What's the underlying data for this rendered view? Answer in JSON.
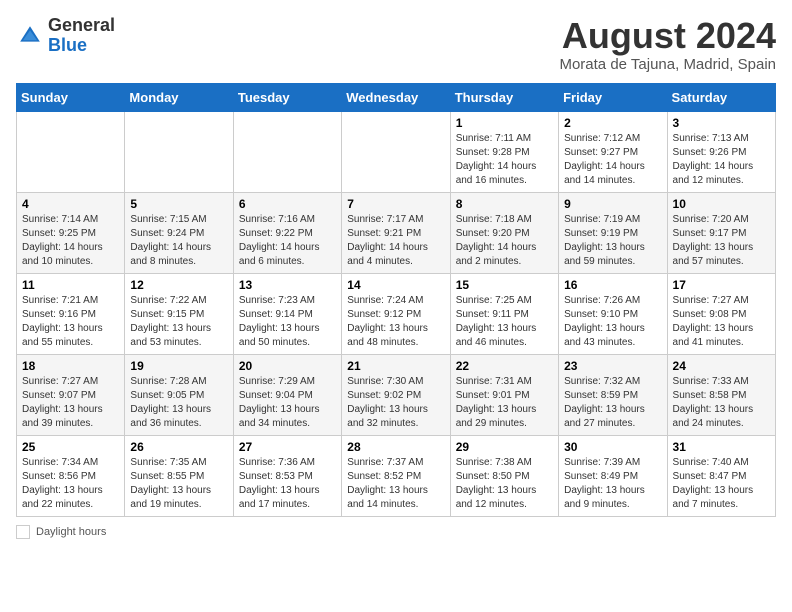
{
  "header": {
    "logo_general": "General",
    "logo_blue": "Blue",
    "title": "August 2024",
    "subtitle": "Morata de Tajuna, Madrid, Spain"
  },
  "weekdays": [
    "Sunday",
    "Monday",
    "Tuesday",
    "Wednesday",
    "Thursday",
    "Friday",
    "Saturday"
  ],
  "weeks": [
    [
      {
        "day": "",
        "info": ""
      },
      {
        "day": "",
        "info": ""
      },
      {
        "day": "",
        "info": ""
      },
      {
        "day": "",
        "info": ""
      },
      {
        "day": "1",
        "info": "Sunrise: 7:11 AM\nSunset: 9:28 PM\nDaylight: 14 hours\nand 16 minutes."
      },
      {
        "day": "2",
        "info": "Sunrise: 7:12 AM\nSunset: 9:27 PM\nDaylight: 14 hours\nand 14 minutes."
      },
      {
        "day": "3",
        "info": "Sunrise: 7:13 AM\nSunset: 9:26 PM\nDaylight: 14 hours\nand 12 minutes."
      }
    ],
    [
      {
        "day": "4",
        "info": "Sunrise: 7:14 AM\nSunset: 9:25 PM\nDaylight: 14 hours\nand 10 minutes."
      },
      {
        "day": "5",
        "info": "Sunrise: 7:15 AM\nSunset: 9:24 PM\nDaylight: 14 hours\nand 8 minutes."
      },
      {
        "day": "6",
        "info": "Sunrise: 7:16 AM\nSunset: 9:22 PM\nDaylight: 14 hours\nand 6 minutes."
      },
      {
        "day": "7",
        "info": "Sunrise: 7:17 AM\nSunset: 9:21 PM\nDaylight: 14 hours\nand 4 minutes."
      },
      {
        "day": "8",
        "info": "Sunrise: 7:18 AM\nSunset: 9:20 PM\nDaylight: 14 hours\nand 2 minutes."
      },
      {
        "day": "9",
        "info": "Sunrise: 7:19 AM\nSunset: 9:19 PM\nDaylight: 13 hours\nand 59 minutes."
      },
      {
        "day": "10",
        "info": "Sunrise: 7:20 AM\nSunset: 9:17 PM\nDaylight: 13 hours\nand 57 minutes."
      }
    ],
    [
      {
        "day": "11",
        "info": "Sunrise: 7:21 AM\nSunset: 9:16 PM\nDaylight: 13 hours\nand 55 minutes."
      },
      {
        "day": "12",
        "info": "Sunrise: 7:22 AM\nSunset: 9:15 PM\nDaylight: 13 hours\nand 53 minutes."
      },
      {
        "day": "13",
        "info": "Sunrise: 7:23 AM\nSunset: 9:14 PM\nDaylight: 13 hours\nand 50 minutes."
      },
      {
        "day": "14",
        "info": "Sunrise: 7:24 AM\nSunset: 9:12 PM\nDaylight: 13 hours\nand 48 minutes."
      },
      {
        "day": "15",
        "info": "Sunrise: 7:25 AM\nSunset: 9:11 PM\nDaylight: 13 hours\nand 46 minutes."
      },
      {
        "day": "16",
        "info": "Sunrise: 7:26 AM\nSunset: 9:10 PM\nDaylight: 13 hours\nand 43 minutes."
      },
      {
        "day": "17",
        "info": "Sunrise: 7:27 AM\nSunset: 9:08 PM\nDaylight: 13 hours\nand 41 minutes."
      }
    ],
    [
      {
        "day": "18",
        "info": "Sunrise: 7:27 AM\nSunset: 9:07 PM\nDaylight: 13 hours\nand 39 minutes."
      },
      {
        "day": "19",
        "info": "Sunrise: 7:28 AM\nSunset: 9:05 PM\nDaylight: 13 hours\nand 36 minutes."
      },
      {
        "day": "20",
        "info": "Sunrise: 7:29 AM\nSunset: 9:04 PM\nDaylight: 13 hours\nand 34 minutes."
      },
      {
        "day": "21",
        "info": "Sunrise: 7:30 AM\nSunset: 9:02 PM\nDaylight: 13 hours\nand 32 minutes."
      },
      {
        "day": "22",
        "info": "Sunrise: 7:31 AM\nSunset: 9:01 PM\nDaylight: 13 hours\nand 29 minutes."
      },
      {
        "day": "23",
        "info": "Sunrise: 7:32 AM\nSunset: 8:59 PM\nDaylight: 13 hours\nand 27 minutes."
      },
      {
        "day": "24",
        "info": "Sunrise: 7:33 AM\nSunset: 8:58 PM\nDaylight: 13 hours\nand 24 minutes."
      }
    ],
    [
      {
        "day": "25",
        "info": "Sunrise: 7:34 AM\nSunset: 8:56 PM\nDaylight: 13 hours\nand 22 minutes."
      },
      {
        "day": "26",
        "info": "Sunrise: 7:35 AM\nSunset: 8:55 PM\nDaylight: 13 hours\nand 19 minutes."
      },
      {
        "day": "27",
        "info": "Sunrise: 7:36 AM\nSunset: 8:53 PM\nDaylight: 13 hours\nand 17 minutes."
      },
      {
        "day": "28",
        "info": "Sunrise: 7:37 AM\nSunset: 8:52 PM\nDaylight: 13 hours\nand 14 minutes."
      },
      {
        "day": "29",
        "info": "Sunrise: 7:38 AM\nSunset: 8:50 PM\nDaylight: 13 hours\nand 12 minutes."
      },
      {
        "day": "30",
        "info": "Sunrise: 7:39 AM\nSunset: 8:49 PM\nDaylight: 13 hours\nand 9 minutes."
      },
      {
        "day": "31",
        "info": "Sunrise: 7:40 AM\nSunset: 8:47 PM\nDaylight: 13 hours\nand 7 minutes."
      }
    ]
  ],
  "footer": {
    "daylight_label": "Daylight hours"
  }
}
